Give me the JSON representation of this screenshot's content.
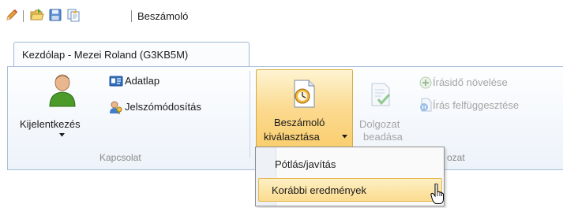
{
  "qat": {
    "icons": [
      "pencil-icon",
      "open-folder-icon",
      "save-disk-icon",
      "copy-icon"
    ],
    "title": "Beszámoló"
  },
  "tab": {
    "label": "Kezdólap - Mezei Roland (G3KB5M)"
  },
  "ribbon": {
    "kapcsolat": {
      "label": "Kapcsolat",
      "kijelentkezes": "Kijelentkezés",
      "adatlap": "Adatlap",
      "jelszomodositas": "Jelszómódosítás"
    },
    "dolgozat": {
      "label_fragment": "ozat",
      "beszamolo_line1": "Beszámoló",
      "beszamolo_line2": "kiválasztása",
      "dolgozat_line1": "Dolgozat",
      "dolgozat_line2": "beadása",
      "irasido": "Írásidő növelése",
      "iras_felf": "Írás felfüggesztése"
    }
  },
  "dropdown": {
    "items": [
      {
        "label": "Pótlás/javítás",
        "highlighted": false
      },
      {
        "label": "Korábbi eredmények",
        "highlighted": true
      }
    ]
  },
  "colors": {
    "highlight_top": "#fef4d2",
    "highlight_bottom": "#f9cd6c",
    "highlight_border": "#d8a940",
    "ribbon_border": "#aabfdc",
    "disabled_text": "#a4a4a4"
  }
}
